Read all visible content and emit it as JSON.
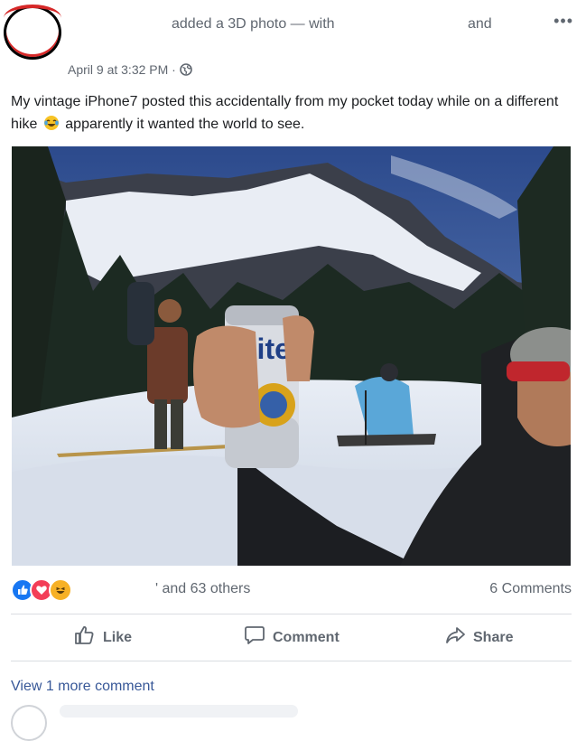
{
  "header": {
    "action_text": "added a 3D photo — with",
    "conjunction": "and",
    "more_icon": "more-horizontal-icon",
    "timestamp": "April 9 at 3:32 PM ·",
    "privacy_icon": "globe-icon"
  },
  "post": {
    "text_part1": "My vintage iPhone7 posted this accidentally from my pocket today while on a different hike",
    "text_part2": "apparently it wanted the world to see.",
    "emoji_icon": "laughing-tears-emoji",
    "can_label": "Lite"
  },
  "stats": {
    "reaction_icons": [
      "like-reaction-icon",
      "love-reaction-icon",
      "haha-reaction-icon"
    ],
    "reactors_text": "' and 63 others",
    "comments_text": "6 Comments"
  },
  "actions": {
    "like": "Like",
    "comment": "Comment",
    "share": "Share"
  },
  "comments": {
    "view_more": "View 1 more comment"
  },
  "colors": {
    "link": "#385898",
    "like_blue": "#1877f2",
    "love_red": "#f33e58",
    "haha_yellow": "#f7b125",
    "muted_text": "#606770"
  }
}
